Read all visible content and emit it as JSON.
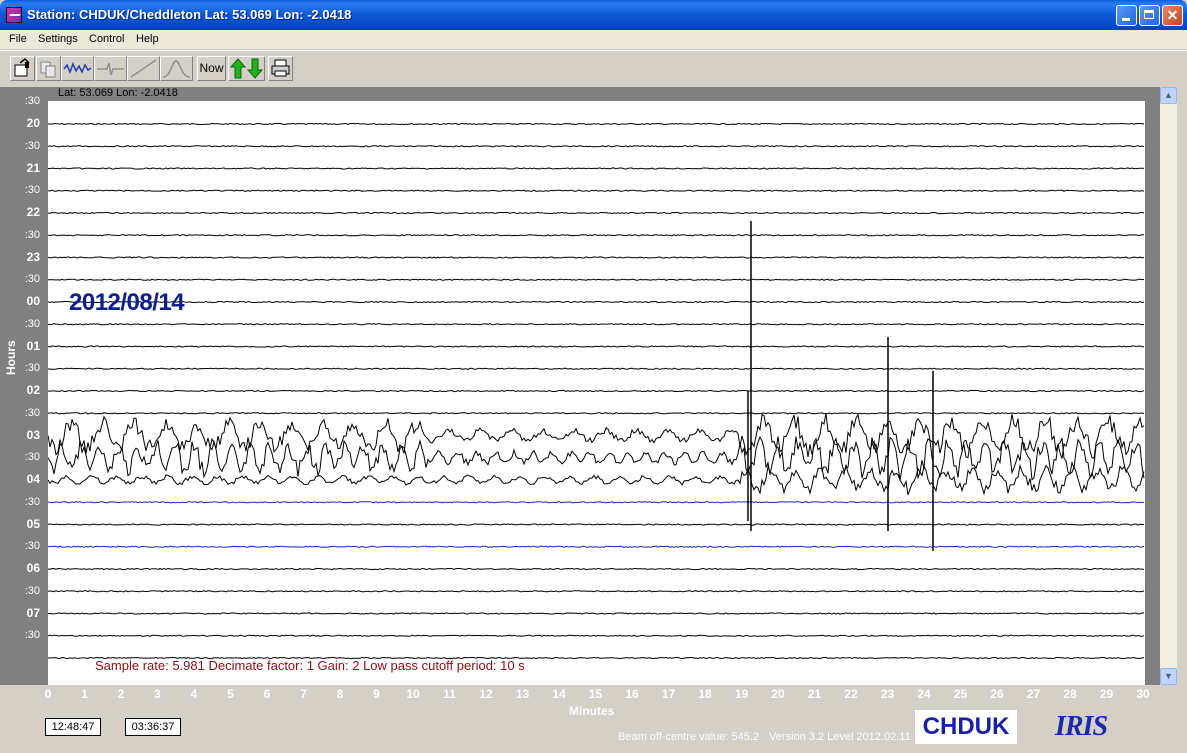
{
  "window": {
    "title": "Station: CHDUK/Cheddleton Lat: 53.069 Lon: -2.0418"
  },
  "menu": [
    "File",
    "Settings",
    "Control",
    "Help"
  ],
  "toolbar": {
    "now_label": "Now",
    "buttons": [
      "open-icon",
      "copy-icon",
      "waveform-icon",
      "filter-icon",
      "slope-icon",
      "pulse-icon",
      "now-button",
      "up-down-arrows-icon",
      "printer-icon"
    ]
  },
  "plot": {
    "latlon": "Lat: 53.069 Lon: -2.0418",
    "date": "2012/08/14",
    "hour_labels": [
      ":30",
      "20",
      ":30",
      "21",
      ":30",
      "22",
      ":30",
      "23",
      ":30",
      "00",
      ":30",
      "01",
      ":30",
      "02",
      ":30",
      "03",
      ":30",
      "04",
      ":30",
      "05",
      ":30",
      "06",
      ":30",
      "07",
      ":30"
    ],
    "y_axis_title": "Hours",
    "x_axis_title": "Minutes",
    "x_ticks": [
      "0",
      "1",
      "2",
      "3",
      "4",
      "5",
      "6",
      "7",
      "8",
      "9",
      "10",
      "11",
      "12",
      "13",
      "14",
      "15",
      "16",
      "17",
      "18",
      "19",
      "20",
      "21",
      "22",
      "23",
      "24",
      "25",
      "26",
      "27",
      "28",
      "29",
      "30"
    ],
    "sample_info": "Sample rate: 5.981  Decimate factor: 1  Gain: 2  Low pass cutoff period: 10 s"
  },
  "status": {
    "time_left": "12:48:47",
    "time_right": "03:36:37",
    "beam": "Beam off-centre value: 545.2",
    "version": "Version 3.2 Level 2012.02.11",
    "logo_chduk": "CHDUK",
    "logo_iris": "IRIS"
  },
  "colors": {
    "trace": "#000000",
    "trace_blue": "#1a2aa0",
    "date": "#0d1f8c",
    "info": "#8b1010"
  }
}
